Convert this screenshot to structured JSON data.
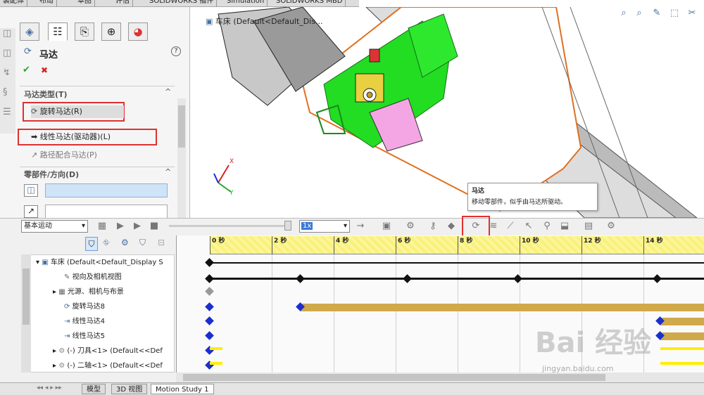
{
  "top_tabs": [
    "装配体",
    "布局",
    "草图",
    "评估",
    "SOLIDWORKS 插件",
    "Simulation",
    "SOLIDWORKS MBD"
  ],
  "viewport": {
    "tree_label": "车床 (Default<Default_Dis...",
    "axis_x": "X",
    "axis_y": "Y"
  },
  "property_manager": {
    "title": "马达",
    "help": "?",
    "ok": "✔",
    "cancel": "✖",
    "motor_type_section": "马达类型(T)",
    "options": [
      "旋转马达(R)",
      "线性马达(驱动器)(L)",
      "路径配合马达(P)"
    ],
    "component_section": "零部件/方向(D)"
  },
  "tooltip": {
    "title": "马达",
    "body": "移动零部件，似乎由马达所驱动。"
  },
  "timeline": {
    "study_type": "基本运动",
    "speed": "1x",
    "ticks": [
      "0 秒",
      "2 秒",
      "4 秒",
      "6 秒",
      "8 秒",
      "10 秒",
      "12 秒",
      "14 秒"
    ],
    "tree_rows": [
      "车床 (Default<Default_Display S",
      "视向及相机视图",
      "光源、相机与布景",
      "旋转马达8",
      "线性马达4",
      "线性马达5",
      "(-) 刀具<1> (Default<<Def",
      "(-) 二轴<1> (Default<<Def"
    ]
  },
  "bottom_tabs": [
    "模型",
    "3D 视图",
    "Motion Study 1"
  ],
  "watermark": {
    "main": "Bai 经验",
    "sub": "jingyan.baidu.com"
  },
  "colors": {
    "accent_green": "#22dd22",
    "bar_gold": "#d0a94a",
    "key_blue": "#1a2fd0",
    "highlight_red": "#e03030"
  }
}
